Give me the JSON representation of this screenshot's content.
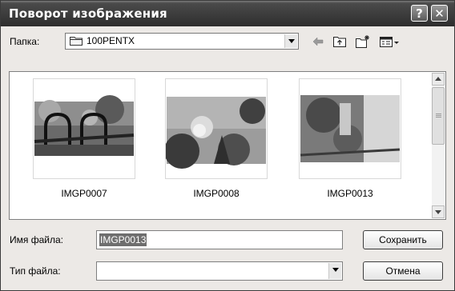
{
  "window": {
    "title": "Поворот изображения",
    "help_glyph": "?",
    "close_glyph": "✕"
  },
  "toolbar": {
    "folder_label": "Папка:",
    "folder_value": "100PENTX",
    "icons": [
      "back-arrow-icon",
      "up-folder-icon",
      "new-folder-icon",
      "view-menu-icon"
    ]
  },
  "files": [
    {
      "name": "IMGP0007"
    },
    {
      "name": "IMGP0008"
    },
    {
      "name": "IMGP0013"
    }
  ],
  "form": {
    "filename_label": "Имя файла:",
    "filename_value": "IMGP0013",
    "filetype_label": "Тип файла:",
    "filetype_value": "",
    "save_label": "Сохранить",
    "cancel_label": "Отмена"
  }
}
